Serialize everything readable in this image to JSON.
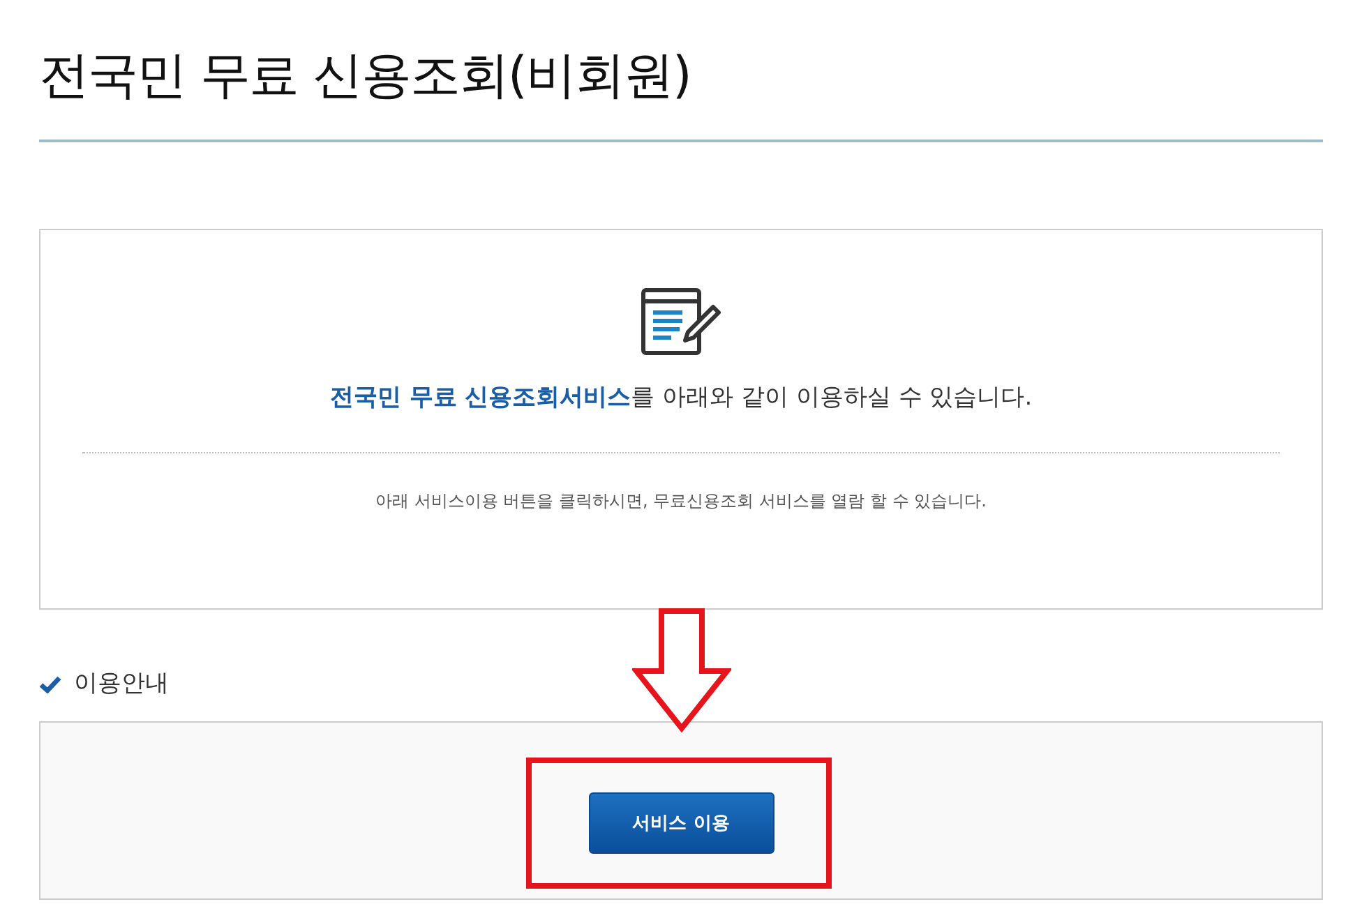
{
  "page": {
    "title": "전국민 무료 신용조회(비회원)"
  },
  "intro_card": {
    "headline": "**전국민 무료 신용조회서비스**를 아래와 같이 이용하실 수 있습니다.",
    "note": "아래 서비스이용 버튼을 클릭하시면, 무료신용조회 서비스를 열람 할 수 있습니다."
  },
  "usage_section": {
    "heading": "이용안내",
    "button": "서비스 이용"
  }
}
